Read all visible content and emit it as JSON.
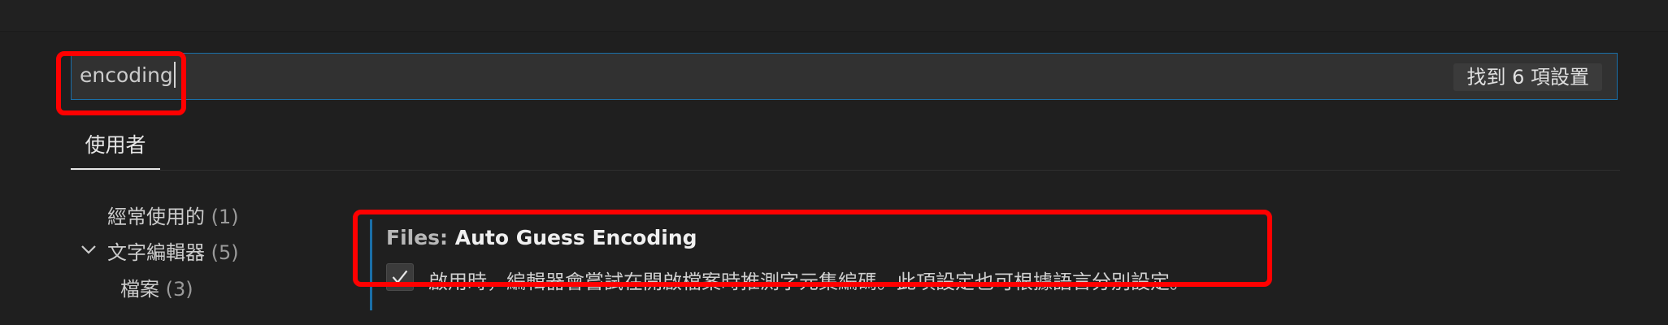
{
  "search": {
    "value": "encoding",
    "result_count": "找到 6 項設置"
  },
  "tabs": [
    {
      "label": "使用者"
    }
  ],
  "toc": {
    "items": [
      {
        "label": "經常使用的",
        "count": "(1)"
      },
      {
        "label": "文字編輯器",
        "count": "(5)",
        "expanded": true
      },
      {
        "label": "檔案",
        "count": "(3)"
      }
    ]
  },
  "setting": {
    "category": "Files: ",
    "name": "Auto Guess Encoding",
    "checked": true,
    "description": "啟用時，編輯器會嘗試在開啟檔案時推測字元集編碼。此項設定也可根據語言分別設定。"
  },
  "colors": {
    "accent": "#1a6fa8",
    "annotation": "#ff0000"
  },
  "icons": [
    "chevron-down-icon",
    "check-icon"
  ]
}
